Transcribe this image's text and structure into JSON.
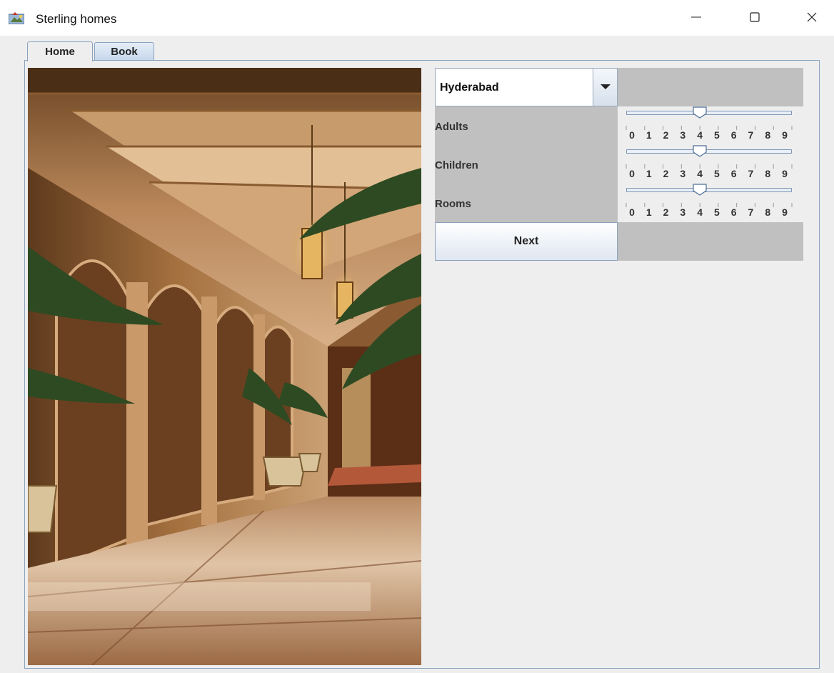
{
  "window": {
    "title": "Sterling homes",
    "icons": {
      "app": "app-window-icon",
      "minimize": "minimize-icon",
      "maximize": "maximize-icon",
      "close": "close-icon"
    }
  },
  "tabs": [
    {
      "label": "Home",
      "selected": true
    },
    {
      "label": "Book",
      "selected": false
    }
  ],
  "form": {
    "city": {
      "selected": "Hyderabad",
      "icon": "chevron-down-icon"
    },
    "sliders": [
      {
        "label": "Adults",
        "value": 4,
        "min": 0,
        "max": 9
      },
      {
        "label": "Children",
        "value": 4,
        "min": 0,
        "max": 9
      },
      {
        "label": "Rooms",
        "value": 4,
        "min": 0,
        "max": 9
      }
    ],
    "tick_labels": [
      "0",
      "1",
      "2",
      "3",
      "4",
      "5",
      "6",
      "7",
      "8",
      "9"
    ],
    "next_label": "Next"
  },
  "colors": {
    "gray_cell": "#c0c0c0",
    "panel_bg": "#eeeeee",
    "border": "#8aa2bd"
  }
}
